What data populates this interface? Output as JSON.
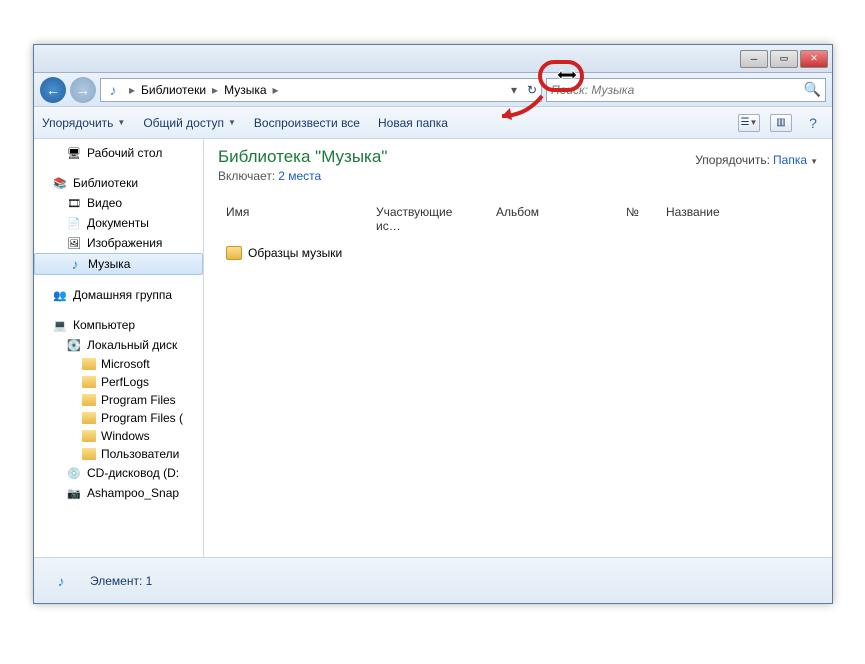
{
  "breadcrumb": {
    "root": "Библиотеки",
    "current": "Музыка"
  },
  "search": {
    "placeholder": "Поиск: Музыка"
  },
  "toolbar": {
    "organize": "Упорядочить",
    "share": "Общий доступ",
    "play_all": "Воспроизвести все",
    "new_folder": "Новая папка"
  },
  "sidebar": {
    "desktop": "Рабочий стол",
    "libraries": "Библиотеки",
    "video": "Видео",
    "documents": "Документы",
    "images": "Изображения",
    "music": "Музыка",
    "homegroup": "Домашняя группа",
    "computer": "Компьютер",
    "localdisk": "Локальный диск",
    "f_microsoft": "Microsoft",
    "f_perflogs": "PerfLogs",
    "f_programfiles": "Program Files",
    "f_programfiles2": "Program Files (",
    "f_windows": "Windows",
    "f_users": "Пользователи",
    "cddrive": "CD-дисковод (D:",
    "ashampoo": "Ashampoo_Snap"
  },
  "content": {
    "title": "Библиотека \"Музыка\"",
    "includes_label": "Включает:",
    "includes_link": "2 места",
    "sort_label": "Упорядочить:",
    "sort_value": "Папка",
    "columns": {
      "name": "Имя",
      "artists": "Участвующие ис…",
      "album": "Альбом",
      "num": "№",
      "title_col": "Название"
    },
    "items": [
      {
        "name": "Образцы музыки"
      }
    ]
  },
  "status": {
    "text": "Элемент: 1"
  }
}
